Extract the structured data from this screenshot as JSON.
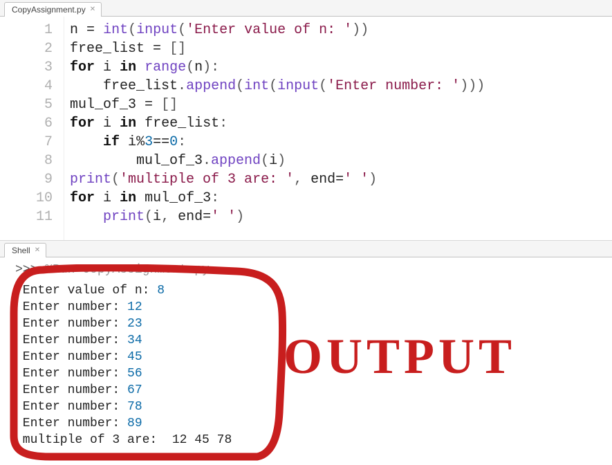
{
  "tabs": {
    "editor": "CopyAssignment.py",
    "shell": "Shell"
  },
  "editor": {
    "lines": [
      {
        "num": "1",
        "tokens": [
          "n",
          " ",
          "=",
          " ",
          "int",
          "(",
          "input",
          "(",
          "'Enter value of n: '",
          ")",
          ")"
        ],
        "types": [
          "nm",
          "sp",
          "op",
          "sp",
          "fn",
          "punc",
          "fn",
          "punc",
          "str",
          "punc",
          "punc"
        ]
      },
      {
        "num": "2",
        "tokens": [
          "free_list",
          " ",
          "=",
          " ",
          "[",
          "]"
        ],
        "types": [
          "nm",
          "sp",
          "op",
          "sp",
          "punc",
          "punc"
        ]
      },
      {
        "num": "3",
        "tokens": [
          "for",
          " ",
          "i",
          " ",
          "in",
          " ",
          "range",
          "(",
          "n",
          ")",
          ":"
        ],
        "types": [
          "kw",
          "sp",
          "nm",
          "sp",
          "kw",
          "sp",
          "fn",
          "punc",
          "nm",
          "punc",
          "punc"
        ]
      },
      {
        "num": "4",
        "indent": 1,
        "tokens": [
          "free_list",
          ".",
          "append",
          "(",
          "int",
          "(",
          "input",
          "(",
          "'Enter number: '",
          ")",
          ")",
          ")"
        ],
        "types": [
          "nm",
          "punc",
          "fn",
          "punc",
          "fn",
          "punc",
          "fn",
          "punc",
          "str",
          "punc",
          "punc",
          "punc"
        ]
      },
      {
        "num": "5",
        "tokens": [
          "mul_of_3",
          " ",
          "=",
          " ",
          "[",
          "]"
        ],
        "types": [
          "nm",
          "sp",
          "op",
          "sp",
          "punc",
          "punc"
        ]
      },
      {
        "num": "6",
        "tokens": [
          "for",
          " ",
          "i",
          " ",
          "in",
          " ",
          "free_list",
          ":"
        ],
        "types": [
          "kw",
          "sp",
          "nm",
          "sp",
          "kw",
          "sp",
          "nm",
          "punc"
        ]
      },
      {
        "num": "7",
        "indent": 1,
        "tokens": [
          "if",
          " ",
          "i",
          "%",
          "3",
          "==",
          "0",
          ":"
        ],
        "types": [
          "kw",
          "sp",
          "nm",
          "op",
          "num",
          "op",
          "num",
          "punc"
        ]
      },
      {
        "num": "8",
        "indent": 2,
        "tokens": [
          "mul_of_3",
          ".",
          "append",
          "(",
          "i",
          ")"
        ],
        "types": [
          "nm",
          "punc",
          "fn",
          "punc",
          "nm",
          "punc"
        ]
      },
      {
        "num": "9",
        "tokens": [
          "print",
          "(",
          "'multiple of 3 are: '",
          ",",
          " ",
          "end",
          "=",
          "' '",
          ")"
        ],
        "types": [
          "fn",
          "punc",
          "str",
          "punc",
          "sp",
          "nm",
          "op",
          "str",
          "punc"
        ]
      },
      {
        "num": "10",
        "tokens": [
          "for",
          " ",
          "i",
          " ",
          "in",
          " ",
          "mul_of_3",
          ":"
        ],
        "types": [
          "kw",
          "sp",
          "nm",
          "sp",
          "kw",
          "sp",
          "nm",
          "punc"
        ]
      },
      {
        "num": "11",
        "indent": 1,
        "tokens": [
          "print",
          "(",
          "i",
          ",",
          " ",
          "end",
          "=",
          "' '",
          ")"
        ],
        "types": [
          "fn",
          "punc",
          "nm",
          "punc",
          "sp",
          "nm",
          "op",
          "str",
          "punc"
        ]
      }
    ]
  },
  "shell": {
    "prompt": ">>>",
    "run_command": "%Run CopyAssignment.py",
    "lines": [
      {
        "text": "Enter value of n: ",
        "value": "8"
      },
      {
        "text": "Enter number: ",
        "value": "12"
      },
      {
        "text": "Enter number: ",
        "value": "23"
      },
      {
        "text": "Enter number: ",
        "value": "34"
      },
      {
        "text": "Enter number: ",
        "value": "45"
      },
      {
        "text": "Enter number: ",
        "value": "56"
      },
      {
        "text": "Enter number: ",
        "value": "67"
      },
      {
        "text": "Enter number: ",
        "value": "78"
      },
      {
        "text": "Enter number: ",
        "value": "89"
      },
      {
        "text": "multiple of 3 are:  12 45 78",
        "value": null
      }
    ]
  },
  "annotation": {
    "label": "OUTPUT",
    "color": "#c81e1e"
  }
}
